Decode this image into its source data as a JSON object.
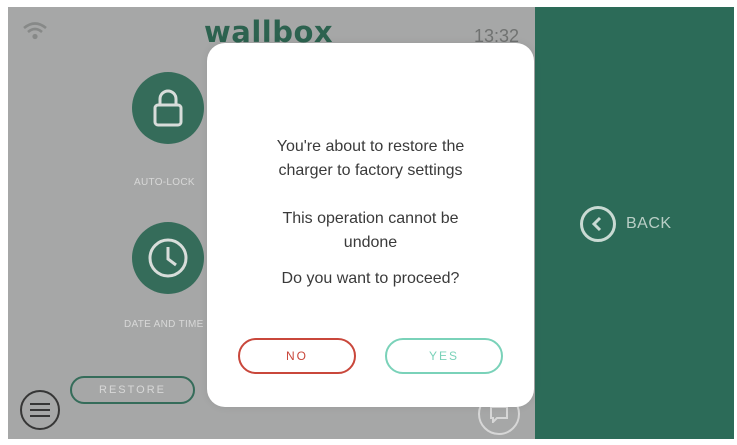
{
  "header": {
    "logo": "wallbox",
    "time": "13:32"
  },
  "menu": {
    "auto_lock_label": "AUTO-LOCK",
    "date_time_label": "DATE AND TIME"
  },
  "restore_button": "RESTORE",
  "side_panel": {
    "back_label": "BACK"
  },
  "dialog": {
    "line1": "You're about to restore the",
    "line2": "charger to factory settings",
    "line3": "This operation cannot be",
    "line4": "undone",
    "question": "Do you want to proceed?",
    "no_label": "NO",
    "yes_label": "YES"
  },
  "colors": {
    "brand_green": "#2c6b58",
    "no_red": "#c9473b",
    "yes_teal": "#7ad2b9"
  }
}
